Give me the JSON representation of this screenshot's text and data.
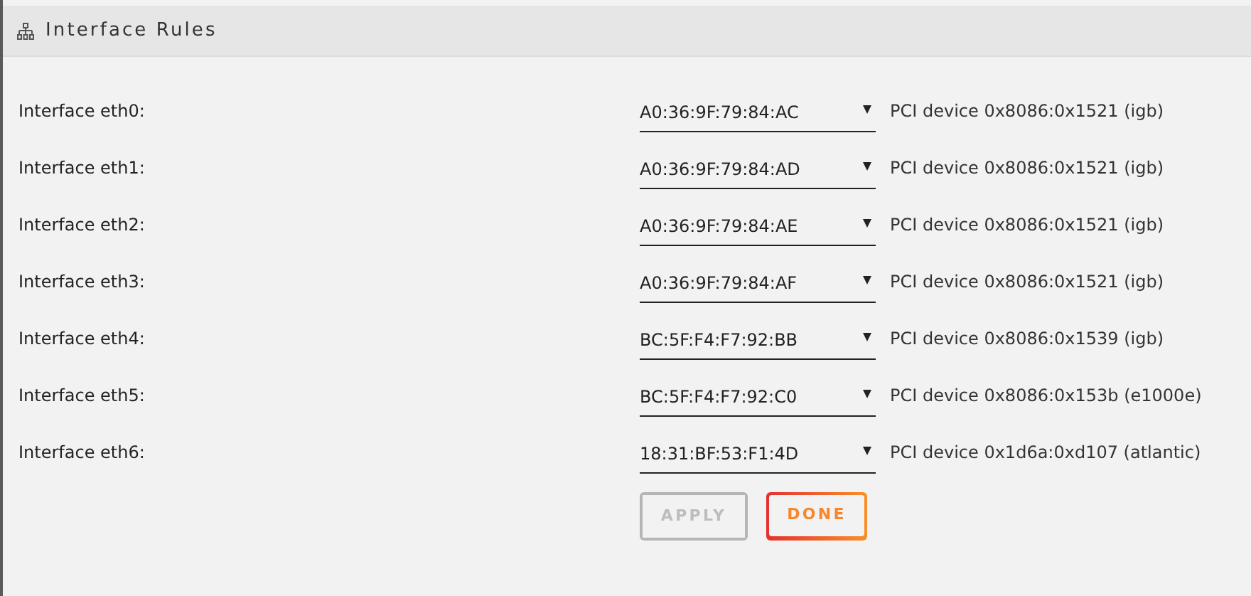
{
  "panel": {
    "title": "Interface Rules"
  },
  "interfaces": [
    {
      "label": "Interface eth0:",
      "mac": "A0:36:9F:79:84:AC",
      "device": "PCI device 0x8086:0x1521 (igb)"
    },
    {
      "label": "Interface eth1:",
      "mac": "A0:36:9F:79:84:AD",
      "device": "PCI device 0x8086:0x1521 (igb)"
    },
    {
      "label": "Interface eth2:",
      "mac": "A0:36:9F:79:84:AE",
      "device": "PCI device 0x8086:0x1521 (igb)"
    },
    {
      "label": "Interface eth3:",
      "mac": "A0:36:9F:79:84:AF",
      "device": "PCI device 0x8086:0x1521 (igb)"
    },
    {
      "label": "Interface eth4:",
      "mac": "BC:5F:F4:F7:92:BB",
      "device": "PCI device 0x8086:0x1539 (igb)"
    },
    {
      "label": "Interface eth5:",
      "mac": "BC:5F:F4:F7:92:C0",
      "device": "PCI device 0x8086:0x153b (e1000e)"
    },
    {
      "label": "Interface eth6:",
      "mac": "18:31:BF:53:F1:4D",
      "device": "PCI device 0x1d6a:0xd107 (atlantic)"
    }
  ],
  "buttons": [
    {
      "label": "APPLY",
      "disabled": true
    },
    {
      "label": "DONE",
      "disabled": false
    }
  ]
}
